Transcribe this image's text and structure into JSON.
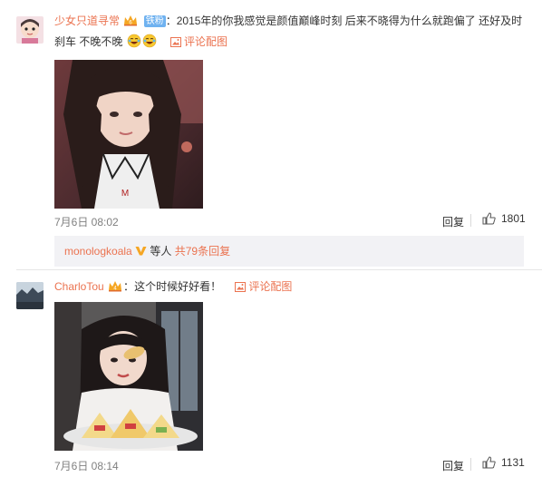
{
  "comments": [
    {
      "username": "少女只道寻常",
      "fan_badge": "铁粉",
      "colon": "：",
      "text_line1": "2015年的你我感觉是颜值巅峰时刻 后来不晓得为什么就跑偏了 还好及时",
      "text_line2": "刹车 不晚不晚",
      "pic_link": "评论配图",
      "date": "7月6日 08:02",
      "reply_label": "回复",
      "like_count": "1801",
      "subreply": {
        "user": "monologkoala",
        "text": " 等人 ",
        "more_link": "共79条回复"
      }
    },
    {
      "username": "CharloTou",
      "colon": "：",
      "text_line1": "这个时候好好看！",
      "pic_link": "评论配图",
      "date": "7月6日 08:14",
      "reply_label": "回复",
      "like_count": "1131"
    }
  ],
  "icons": {
    "vip": "vip-crown-icon",
    "fan_level": "fan-badge",
    "laugh_emoji": "laughing-tears-emoji-icon",
    "picture": "picture-icon",
    "thumbs_up": "thumbs-up-icon",
    "verified": "gold-v-verified-icon"
  },
  "colors": {
    "link": "#eb7350",
    "meta": "#808080",
    "subreply_bg": "#f2f2f5",
    "fan_badge": "#6fb2f0"
  }
}
